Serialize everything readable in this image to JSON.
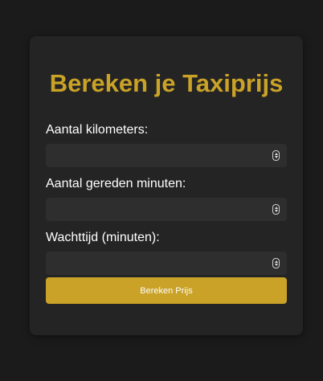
{
  "form": {
    "title": "Bereken je Taxiprijs",
    "fields": [
      {
        "label": "Aantal kilometers:",
        "value": "",
        "type": "number"
      },
      {
        "label": "Aantal gereden minuten:",
        "value": "",
        "type": "number"
      },
      {
        "label": "Wachttijd (minuten):",
        "value": "",
        "type": "number"
      }
    ],
    "submit_label": "Bereken Prijs"
  },
  "colors": {
    "page_background": "#1b1b1b",
    "card_background": "#242424",
    "input_background": "#2e2e2e",
    "accent": "#c9a227",
    "label_text": "#ffffff"
  },
  "icons": {
    "spinner": "number-stepper-icon"
  }
}
